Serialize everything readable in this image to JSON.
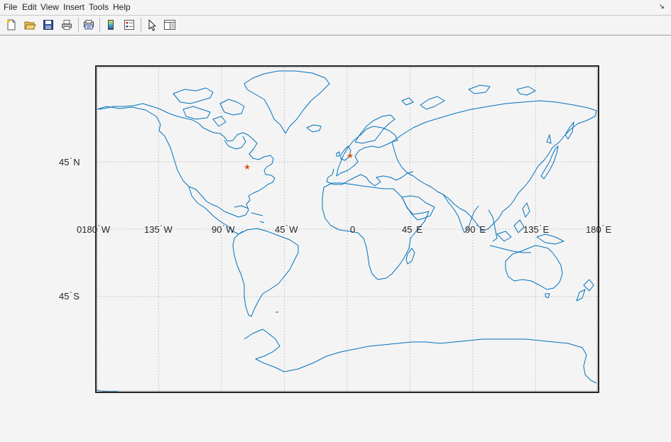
{
  "menubar": {
    "items": [
      "File",
      "Edit",
      "View",
      "Insert",
      "Tools",
      "Help"
    ],
    "dock_glyph": "↘"
  },
  "toolbar": {
    "buttons": [
      {
        "name": "new-figure-icon"
      },
      {
        "name": "open-file-icon"
      },
      {
        "name": "save-icon"
      },
      {
        "name": "print-icon"
      },
      {
        "name": "print-preview-icon"
      },
      {
        "name": "colorbar-icon"
      },
      {
        "name": "legend-icon"
      },
      {
        "name": "pointer-icon"
      },
      {
        "name": "property-editor-icon"
      }
    ]
  },
  "map": {
    "projection": "equirectangular world map",
    "grid": true,
    "colors": {
      "coastline": "#0072bd",
      "marker": "#d95319",
      "frame": "#262626",
      "grid": "#c8c8c8",
      "axes_bg": "#f4f4f4"
    },
    "parallel_labels": [
      {
        "num": "45",
        "hemi": "N"
      },
      {
        "num": "45",
        "hemi": "S"
      }
    ],
    "meridian_labels": [
      {
        "num": "180",
        "hemi": "W"
      },
      {
        "num": "135",
        "hemi": "W"
      },
      {
        "num": "90",
        "hemi": "W"
      },
      {
        "num": "45",
        "hemi": "W"
      },
      {
        "num": "0",
        "hemi": ""
      },
      {
        "num": "45",
        "hemi": "E"
      },
      {
        "num": "90",
        "hemi": "E"
      },
      {
        "num": "135",
        "hemi": "E"
      },
      {
        "num": "180",
        "hemi": "E"
      }
    ],
    "equator_label_prefix": "0",
    "markers": [
      {
        "lon": -74.0,
        "lat": 40.7,
        "symbol": "★"
      },
      {
        "lon": -0.1,
        "lat": 51.5,
        "symbol": "★"
      }
    ]
  }
}
